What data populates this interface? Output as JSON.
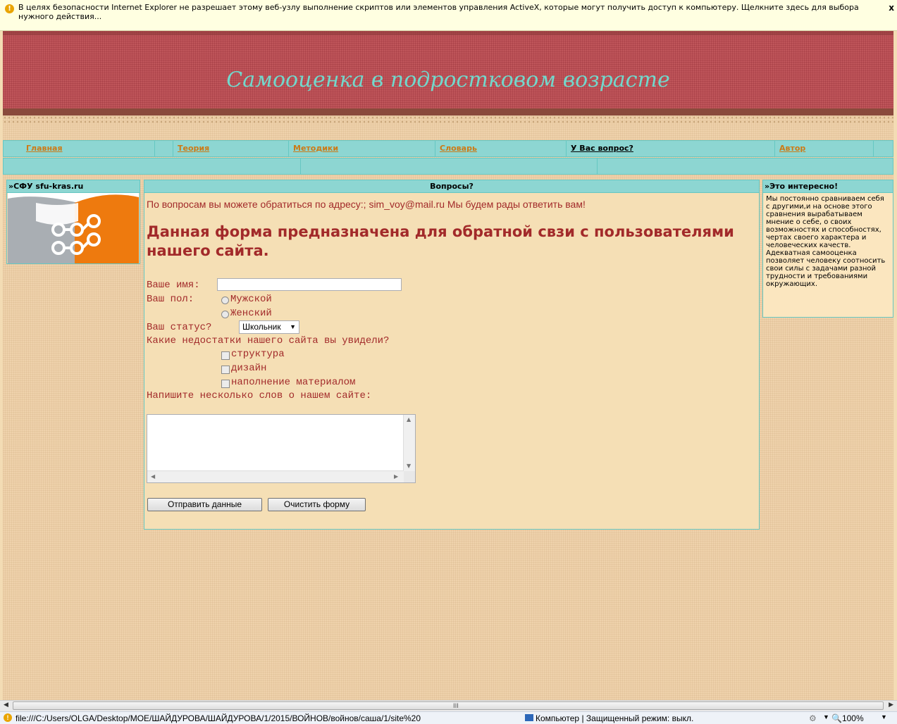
{
  "infobar": {
    "message": "В целях безопасности Internet Explorer не разрешает этому веб-узлу выполнение скриптов или элементов управления ActiveX, которые могут получить доступ к компьютеру. Щелкните здесь для выбора нужного действия...",
    "close": "x"
  },
  "site": {
    "title": "Самооценка в подростковом возрасте"
  },
  "nav": {
    "items": [
      {
        "label": "Главная"
      },
      {
        "label": "Теория"
      },
      {
        "label": "Методики"
      },
      {
        "label": "Словарь"
      },
      {
        "label": "У Вас вопрос?"
      },
      {
        "label": "Автор"
      }
    ]
  },
  "left_panel": {
    "title": "»СФУ sfu-kras.ru"
  },
  "right_panel": {
    "title": "»Это интересно!",
    "text": "Мы постоянно сравниваем себя с другими,и на основе этого сравнения вырабатываем мнение о себе, о своих возможностях и способностях, чертах своего характера и человеческих качеств. Адекватная самооценка позволяет человеку соотносить свои силы с задачами разной трудности и требованиями окружающих."
  },
  "center": {
    "title": "Вопросы?",
    "contact": "По вопросам вы можете обратиться по адресу:; sim_voy@mail.ru Мы будем рады ответить вам!",
    "heading": "Данная форма предназначена для обратной свзи с пользователями нашего сайта."
  },
  "form": {
    "name_label": "Ваше имя:",
    "name_value": "",
    "gender_label": "Ваш пол:",
    "gender_male": "Мужской",
    "gender_female": "Женский",
    "status_label": "Ваш статус?",
    "status_value": "Школьник",
    "flaws_label": "Какие недостатки нашего сайта вы увидели?",
    "flaw_structure": "структура",
    "flaw_design": "дизайн",
    "flaw_content": "наполнение материалом",
    "comment_label": "Напишите несколько слов о нашем сайте:",
    "submit_label": "Отправить данные",
    "reset_label": "Очистить форму"
  },
  "scrollbar": {
    "grip": "III"
  },
  "statusbar": {
    "url": "file:///C:/Users/OLGA/Desktop/МОЕ/ШАЙДУРОВА/ШАЙДУРОВА/1/2015/ВОЙНОВ/войнов/саша/1/site%20",
    "zone": "Компьютер | Защищенный режим: выкл.",
    "zoom": "100%"
  }
}
